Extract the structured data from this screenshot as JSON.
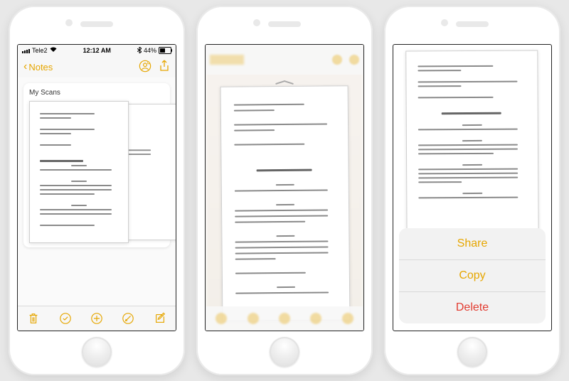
{
  "status": {
    "carrier": "Tele2",
    "wifi_icon": "wifi-icon",
    "time": "12:12 AM",
    "battery_pct": "44%",
    "bluetooth_icon": "bluetooth-icon"
  },
  "notes_top": {
    "back_label": "Notes",
    "add_people_icon": "person-add-icon",
    "share_icon": "share-icon"
  },
  "attachment": {
    "title": "My Scans",
    "page_count": 2
  },
  "notes_bottom_icons": {
    "trash": "trash-icon",
    "checklist": "checklist-icon",
    "add": "plus-circle-icon",
    "draw": "draw-icon",
    "compose": "compose-icon"
  },
  "action_sheet": {
    "share": "Share",
    "copy": "Copy",
    "delete": "Delete"
  },
  "accent_color": "#e6a600",
  "delete_color": "#e23b30"
}
